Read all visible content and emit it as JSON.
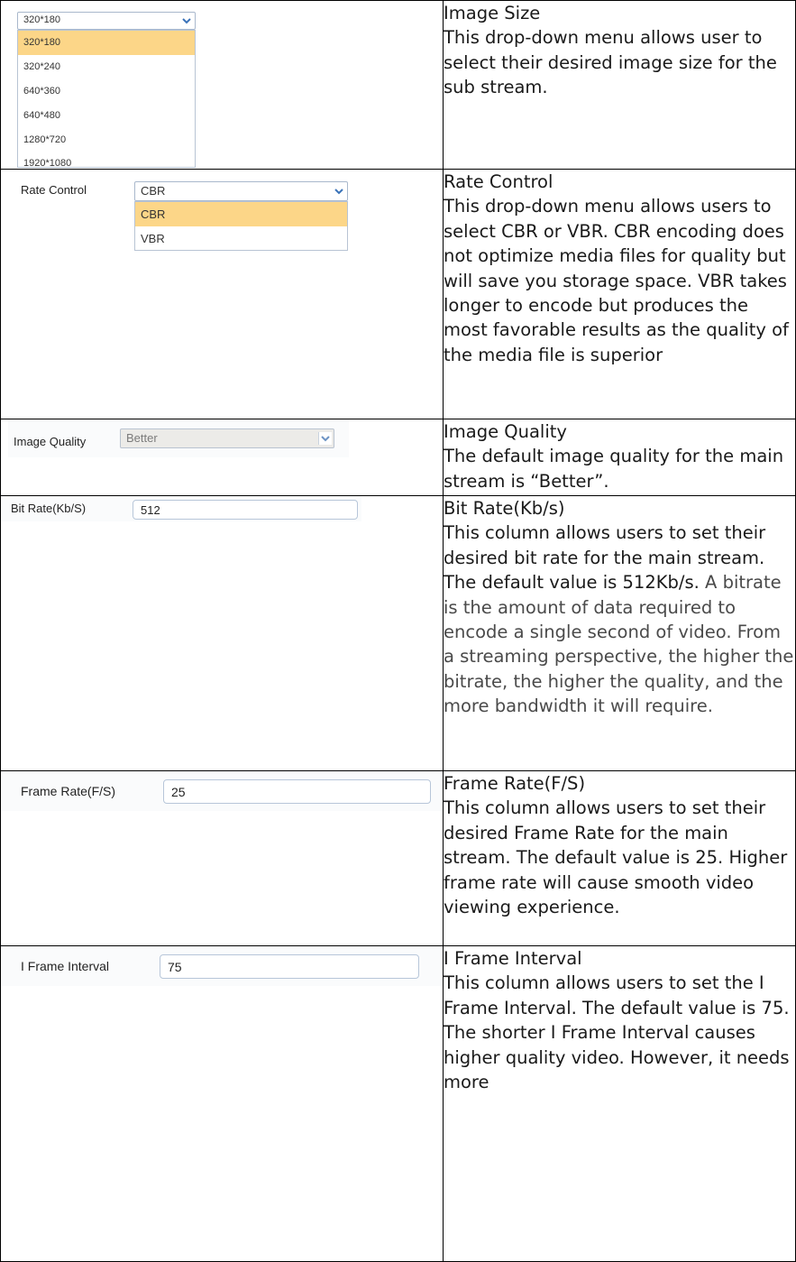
{
  "rows": [
    {
      "ui": {
        "type": "dropdown-open",
        "selected": "320*180",
        "options": [
          "320*180",
          "320*240",
          "640*360",
          "640*480",
          "1280*720",
          "1920*1080"
        ],
        "highlighted": "320*180"
      },
      "title": "Image Size",
      "body": "This drop-down menu allows user to select their desired image size for the sub stream."
    },
    {
      "ui": {
        "type": "dropdown-open",
        "label": "Rate Control",
        "selected": "CBR",
        "options": [
          "CBR",
          "VBR"
        ],
        "highlighted": "CBR"
      },
      "title": "Rate Control",
      "body": "This drop-down menu allows users to select CBR or VBR. CBR encoding does not optimize media files for quality but will save you storage space. VBR takes longer to encode but produces the most favorable results as the quality of the  media file is superior"
    },
    {
      "ui": {
        "type": "dropdown-disabled",
        "label": "Image Quality",
        "selected": "Better"
      },
      "title": "Image Quality",
      "body": "The default image quality for the main stream is “Better”."
    },
    {
      "ui": {
        "type": "input",
        "label": "Bit Rate(Kb/S)",
        "value": "512"
      },
      "title": "Bit Rate(Kb/s)",
      "body": "This column allows users to set their desired bit rate for the main stream. The default value is 512Kb/s.",
      "body_grey": " A bitrate is the amount of data required to encode a single second of video. From a streaming perspective, the higher the bitrate, the higher the quality, and the more bandwidth it will require."
    },
    {
      "ui": {
        "type": "input",
        "label": "Frame Rate(F/S)",
        "value": "25"
      },
      "title": "Frame Rate(F/S)",
      "body": "This column allows users to set their desired Frame Rate for the main stream. The default value is 25. Higher frame rate will cause smooth video viewing experience."
    },
    {
      "ui": {
        "type": "input",
        "label": "I Frame Interval",
        "value": "75"
      },
      "title": "I Frame Interval",
      "body": "This column allows users to set the I Frame Interval. The default value is 75. The shorter I Frame Interval causes higher quality video. However, it needs more"
    }
  ],
  "icons": {
    "chevron": "chevron-down-icon",
    "chevron_color": "#3b73b9"
  }
}
